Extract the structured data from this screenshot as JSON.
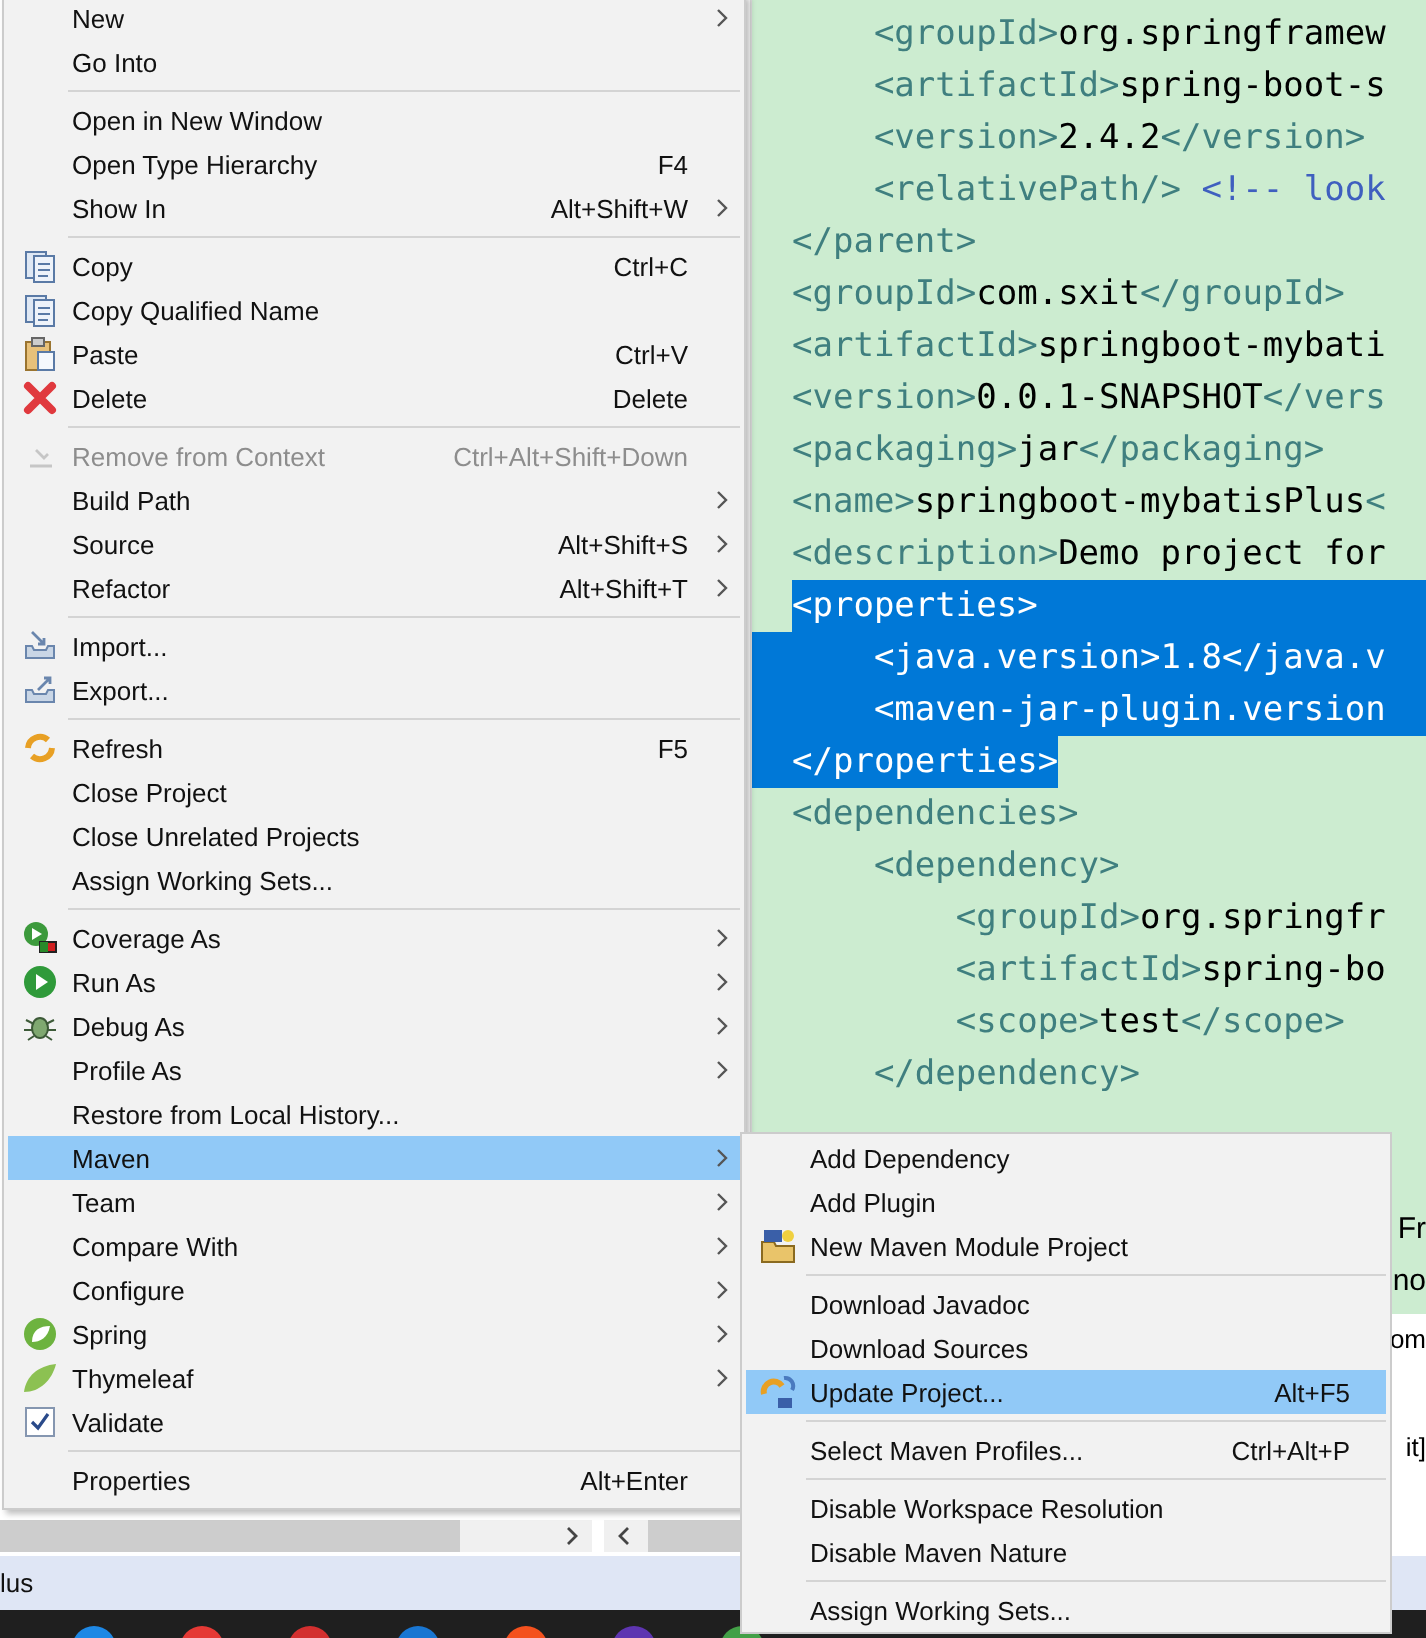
{
  "editor": {
    "lines": [
      {
        "kind": "group",
        "children": [
          {
            "kind": "code",
            "selected": false,
            "tokens": [
              {
                "kind": "tag",
                "s": "<groupId>"
              },
              {
                "kind": "text",
                "s": "org.springframew"
              }
            ]
          },
          {
            "kind": "code",
            "selected": false,
            "tokens": [
              {
                "kind": "tag",
                "s": "<artifactId>"
              },
              {
                "kind": "text",
                "s": "spring-boot-s"
              }
            ]
          },
          {
            "kind": "code",
            "selected": false,
            "tokens": [
              {
                "kind": "tag",
                "s": "<version>"
              },
              {
                "kind": "text",
                "s": "2.4.2"
              },
              {
                "kind": "tag",
                "s": "</version>"
              }
            ]
          },
          {
            "kind": "code",
            "selected": false,
            "tokens": [
              {
                "kind": "tag",
                "s": "<relativePath/>"
              },
              {
                "kind": "comment",
                "s": "<!-- look"
              }
            ]
          }
        ]
      },
      {
        "kind": "code",
        "selected": false,
        "tokens": [
          {
            "kind": "tag",
            "s": "</parent>"
          }
        ]
      },
      {
        "kind": "code",
        "selected": false,
        "tokens": [
          {
            "kind": "tag",
            "s": "<groupId>"
          },
          {
            "kind": "text",
            "s": "com.sxit"
          },
          {
            "kind": "tag",
            "s": "</groupId>"
          }
        ]
      },
      {
        "kind": "code",
        "selected": false,
        "tokens": [
          {
            "kind": "tag",
            "s": "<artifactId>"
          },
          {
            "kind": "text",
            "s": "springboot-mybati"
          }
        ]
      },
      {
        "kind": "code",
        "selected": false,
        "tokens": [
          {
            "kind": "tag",
            "s": "<version>"
          },
          {
            "kind": "text",
            "s": "0.0.1-SNAPSHOT"
          },
          {
            "kind": "tag",
            "s": "</vers"
          }
        ]
      },
      {
        "kind": "code",
        "selected": false,
        "tokens": [
          {
            "kind": "tag",
            "s": "<packaging>"
          },
          {
            "kind": "text",
            "s": "jar"
          },
          {
            "kind": "tag",
            "s": "</packaging>"
          }
        ]
      },
      {
        "kind": "code",
        "selected": false,
        "tokens": [
          {
            "kind": "tag",
            "s": "<name>"
          },
          {
            "kind": "text",
            "s": "springboot-mybatisPlus"
          },
          {
            "kind": "tag",
            "s": "<"
          }
        ]
      },
      {
        "kind": "code",
        "selected": false,
        "tokens": [
          {
            "kind": "tag",
            "s": "<description>"
          },
          {
            "kind": "text",
            "s": "Demo project for"
          }
        ]
      },
      {
        "kind": "code",
        "selected": true,
        "tokens": [
          {
            "kind": "tag",
            "s": "<properties>"
          }
        ],
        "children": [
          {
            "kind": "code",
            "selected": true,
            "tokens": [
              {
                "kind": "tag",
                "s": "<java.version>"
              },
              {
                "kind": "text",
                "s": "1.8"
              },
              {
                "kind": "tag",
                "s": "</java.v"
              }
            ]
          },
          {
            "kind": "code",
            "selected": true,
            "tokens": [
              {
                "kind": "tag",
                "s": "<maven-jar-plugin.version"
              }
            ]
          }
        ]
      },
      {
        "kind": "code",
        "selected": true,
        "tokens": [
          {
            "kind": "tag",
            "s": "</properties>"
          }
        ]
      },
      {
        "kind": "code",
        "selected": false,
        "tokens": [
          {
            "kind": "tag",
            "s": "<dependencies>"
          }
        ],
        "children": [
          {
            "kind": "code",
            "selected": false,
            "tokens": [
              {
                "kind": "tag",
                "s": "<dependency>"
              }
            ],
            "children": [
              {
                "kind": "code",
                "selected": false,
                "tokens": [
                  {
                    "kind": "tag",
                    "s": "<groupId>"
                  },
                  {
                    "kind": "text",
                    "s": "org.springfr"
                  }
                ]
              },
              {
                "kind": "code",
                "selected": false,
                "tokens": [
                  {
                    "kind": "tag",
                    "s": "<artifactId>"
                  },
                  {
                    "kind": "text",
                    "s": "spring-bo"
                  }
                ]
              },
              {
                "kind": "code",
                "selected": false,
                "tokens": [
                  {
                    "kind": "tag",
                    "s": "<scope>"
                  },
                  {
                    "kind": "text",
                    "s": "test"
                  },
                  {
                    "kind": "tag",
                    "s": "</scope>"
                  }
                ]
              }
            ]
          },
          {
            "kind": "code",
            "selected": false,
            "tokens": [
              {
                "kind": "tag",
                "s": "</dependency>"
              }
            ]
          }
        ]
      },
      {
        "kind": "hidden"
      },
      {
        "kind": "hidden"
      },
      {
        "kind": "tail",
        "tokens": [
          {
            "kind": "text",
            "s": "Fr"
          }
        ]
      },
      {
        "kind": "tail",
        "tokens": [
          {
            "kind": "text",
            "s": "no"
          }
        ]
      }
    ]
  },
  "console": {
    "fragments": [
      "om",
      "it]"
    ]
  },
  "status_bar": {
    "text": "lus"
  },
  "context_menu": {
    "items": [
      {
        "kind": "item",
        "label": "New",
        "submenu": true,
        "selected": false,
        "disabled": false
      },
      {
        "kind": "item",
        "label": "Go Into",
        "submenu": false,
        "selected": false,
        "disabled": false
      },
      {
        "kind": "separator"
      },
      {
        "kind": "item",
        "label": "Open in New Window",
        "submenu": false,
        "selected": false,
        "disabled": false
      },
      {
        "kind": "item",
        "label": "Open Type Hierarchy",
        "shortcut": "F4",
        "submenu": false,
        "selected": false,
        "disabled": false
      },
      {
        "kind": "item",
        "label": "Show In",
        "shortcut": "Alt+Shift+W",
        "submenu": true,
        "selected": false,
        "disabled": false
      },
      {
        "kind": "separator"
      },
      {
        "kind": "item",
        "label": "Copy",
        "shortcut": "Ctrl+C",
        "submenu": false,
        "selected": false,
        "disabled": false
      },
      {
        "kind": "item",
        "label": "Copy Qualified Name",
        "submenu": false,
        "selected": false,
        "disabled": false
      },
      {
        "kind": "item",
        "label": "Paste",
        "shortcut": "Ctrl+V",
        "submenu": false,
        "selected": false,
        "disabled": false
      },
      {
        "kind": "item",
        "label": "Delete",
        "shortcut": "Delete",
        "submenu": false,
        "selected": false,
        "disabled": false
      },
      {
        "kind": "separator"
      },
      {
        "kind": "item",
        "label": "Remove from Context",
        "shortcut": "Ctrl+Alt+Shift+Down",
        "submenu": false,
        "selected": false,
        "disabled": true
      },
      {
        "kind": "item",
        "label": "Build Path",
        "submenu": true,
        "selected": false,
        "disabled": false
      },
      {
        "kind": "item",
        "label": "Source",
        "shortcut": "Alt+Shift+S",
        "submenu": true,
        "selected": false,
        "disabled": false
      },
      {
        "kind": "item",
        "label": "Refactor",
        "shortcut": "Alt+Shift+T",
        "submenu": true,
        "selected": false,
        "disabled": false
      },
      {
        "kind": "separator"
      },
      {
        "kind": "item",
        "label": "Import...",
        "submenu": false,
        "selected": false,
        "disabled": false
      },
      {
        "kind": "item",
        "label": "Export...",
        "submenu": false,
        "selected": false,
        "disabled": false
      },
      {
        "kind": "separator"
      },
      {
        "kind": "item",
        "label": "Refresh",
        "shortcut": "F5",
        "submenu": false,
        "selected": false,
        "disabled": false
      },
      {
        "kind": "item",
        "label": "Close Project",
        "submenu": false,
        "selected": false,
        "disabled": false
      },
      {
        "kind": "item",
        "label": "Close Unrelated Projects",
        "submenu": false,
        "selected": false,
        "disabled": false
      },
      {
        "kind": "item",
        "label": "Assign Working Sets...",
        "submenu": false,
        "selected": false,
        "disabled": false
      },
      {
        "kind": "separator"
      },
      {
        "kind": "item",
        "label": "Coverage As",
        "submenu": true,
        "selected": false,
        "disabled": false
      },
      {
        "kind": "item",
        "label": "Run As",
        "submenu": true,
        "selected": false,
        "disabled": false
      },
      {
        "kind": "item",
        "label": "Debug As",
        "submenu": true,
        "selected": false,
        "disabled": false
      },
      {
        "kind": "item",
        "label": "Profile As",
        "submenu": true,
        "selected": false,
        "disabled": false
      },
      {
        "kind": "item",
        "label": "Restore from Local History...",
        "submenu": false,
        "selected": false,
        "disabled": false
      },
      {
        "kind": "item",
        "label": "Maven",
        "submenu": true,
        "selected": true,
        "disabled": false
      },
      {
        "kind": "item",
        "label": "Team",
        "submenu": true,
        "selected": false,
        "disabled": false
      },
      {
        "kind": "item",
        "label": "Compare With",
        "submenu": true,
        "selected": false,
        "disabled": false
      },
      {
        "kind": "item",
        "label": "Configure",
        "submenu": true,
        "selected": false,
        "disabled": false
      },
      {
        "kind": "item",
        "label": "Spring",
        "submenu": true,
        "selected": false,
        "disabled": false
      },
      {
        "kind": "item",
        "label": "Thymeleaf",
        "submenu": true,
        "selected": false,
        "disabled": false
      },
      {
        "kind": "item",
        "label": "Validate",
        "submenu": false,
        "selected": false,
        "disabled": false
      },
      {
        "kind": "separator"
      },
      {
        "kind": "item",
        "label": "Properties",
        "shortcut": "Alt+Enter",
        "submenu": false,
        "selected": false,
        "disabled": false
      }
    ]
  },
  "maven_submenu": {
    "items": [
      {
        "kind": "item",
        "label": "Add Dependency",
        "selected": false
      },
      {
        "kind": "item",
        "label": "Add Plugin",
        "selected": false
      },
      {
        "kind": "item",
        "label": "New Maven Module Project",
        "selected": false
      },
      {
        "kind": "separator"
      },
      {
        "kind": "item",
        "label": "Download Javadoc",
        "selected": false
      },
      {
        "kind": "item",
        "label": "Download Sources",
        "selected": false
      },
      {
        "kind": "item",
        "label": "Update Project...",
        "shortcut": "Alt+F5",
        "selected": true
      },
      {
        "kind": "separator"
      },
      {
        "kind": "item",
        "label": "Select Maven Profiles...",
        "shortcut": "Ctrl+Alt+P",
        "selected": false
      },
      {
        "kind": "separator"
      },
      {
        "kind": "item",
        "label": "Disable Workspace Resolution",
        "selected": false
      },
      {
        "kind": "item",
        "label": "Disable Maven Nature",
        "selected": false
      },
      {
        "kind": "separator"
      },
      {
        "kind": "item",
        "label": "Assign Working Sets...",
        "selected": false
      }
    ]
  }
}
